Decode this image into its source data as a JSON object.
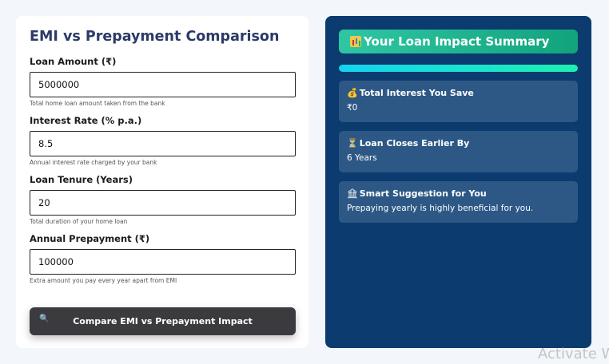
{
  "calculator": {
    "title": "EMI vs Prepayment Comparison",
    "fields": [
      {
        "label": "Loan Amount (₹)",
        "value": "5000000",
        "help": "Total home loan amount taken from the bank"
      },
      {
        "label": "Interest Rate (% p.a.)",
        "value": "8.5",
        "help": "Annual interest rate charged by your bank"
      },
      {
        "label": "Loan Tenure (Years)",
        "value": "20",
        "help": "Total duration of your home loan"
      },
      {
        "label": "Annual Prepayment (₹)",
        "value": "100000",
        "help": "Extra amount you pay every year apart from EMI"
      }
    ],
    "compare_button": {
      "label": "Compare EMI vs Prepayment Impact",
      "icon": "magnifier-icon"
    }
  },
  "summary": {
    "title": "Your Loan Impact Summary",
    "title_icon": "bar-chart-icon",
    "progress_percent": 100,
    "cards": [
      {
        "icon": "money-bag-icon",
        "icon_glyph": "💰",
        "title": "Total Interest You Save",
        "value": "₹0"
      },
      {
        "icon": "hourglass-icon",
        "icon_glyph": "⏳",
        "title": "Loan Closes Earlier By",
        "value": "6 Years"
      },
      {
        "icon": "bank-icon",
        "icon_glyph": "🏦",
        "title": "Smart Suggestion for You",
        "value": "Prepaying yearly is highly beneficial for you."
      }
    ]
  },
  "watermark": "Activate W",
  "colors": {
    "accent_green": "#12a37c",
    "panel_navy": "#0b3b6f",
    "card_blue": "#2d5886",
    "button_dark": "#3b3a3f"
  }
}
